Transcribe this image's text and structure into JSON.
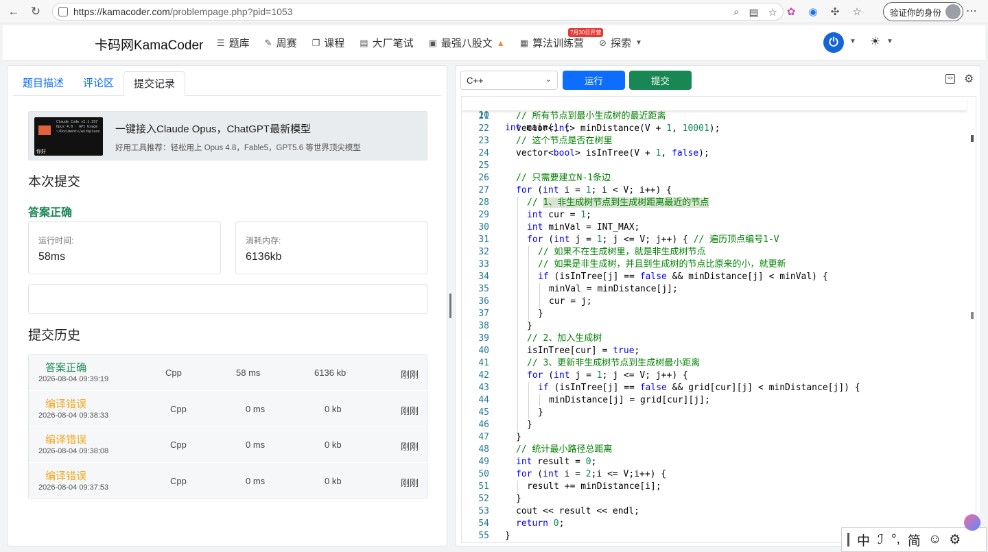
{
  "browser": {
    "url_host": "https://kamacoder.com",
    "url_path": "/problempage.php?pid=1053",
    "profile_label": "验证你的身份"
  },
  "site": {
    "brand": "卡码网KamaCoder",
    "nav": [
      "题库",
      "周赛",
      "课程",
      "大厂笔试",
      "最强八股文",
      "算法训练营",
      "探索"
    ],
    "nav_badge": "7月30日开营"
  },
  "left": {
    "tabs": [
      "题目描述",
      "评论区",
      "提交记录"
    ],
    "promo": {
      "thumb_lines": [
        "Claude Code v2.1.197",
        "Opus 4.8 · API Usage",
        "~/Documents/workplace"
      ],
      "thumb_watermark": "你好",
      "title": "一键接入Claude Opus，ChatGPT最新模型",
      "subtitle": "好用工具推荐：轻松用上 Opus 4.8，Fable5，GPT5.6 等世界顶尖模型"
    },
    "this_submission": "本次提交",
    "verdict": "答案正确",
    "runtime_label": "运行时间:",
    "runtime_value": "58ms",
    "memory_label": "消耗内存:",
    "memory_value": "6136kb",
    "history_title": "提交历史",
    "history": [
      {
        "status": "答案正确",
        "kind": "ok",
        "date": "2026-08-04 09:39:19",
        "lang": "Cpp",
        "time": "58 ms",
        "mem": "6136 kb",
        "when": "刚刚"
      },
      {
        "status": "编译错误",
        "kind": "err",
        "date": "2026-08-04 09:38:33",
        "lang": "Cpp",
        "time": "0 ms",
        "mem": "0 kb",
        "when": "刚刚"
      },
      {
        "status": "编译错误",
        "kind": "err",
        "date": "2026-08-04 09:38:08",
        "lang": "Cpp",
        "time": "0 ms",
        "mem": "0 kb",
        "when": "刚刚"
      },
      {
        "status": "编译错误",
        "kind": "err",
        "date": "2026-08-04 09:37:53",
        "lang": "Cpp",
        "time": "0 ms",
        "mem": "0 kb",
        "when": "刚刚"
      }
    ]
  },
  "editor": {
    "language": "C++",
    "run_label": "运行",
    "submit_label": "提交",
    "sticky": {
      "num": "10",
      "code": "int main() {"
    },
    "lines": [
      {
        "n": "21",
        "i": 1,
        "t": "// 所有节点到最小生成树的最近距离"
      },
      {
        "n": "22",
        "i": 1,
        "t": "vector<int> minDistance(V + 1, 10001);"
      },
      {
        "n": "23",
        "i": 1,
        "t": "// 这个节点是否在树里"
      },
      {
        "n": "24",
        "i": 1,
        "t": "vector<bool> isInTree(V + 1, false);"
      },
      {
        "n": "25",
        "i": 0,
        "t": ""
      },
      {
        "n": "26",
        "i": 1,
        "t": "// 只需要建立N-1条边"
      },
      {
        "n": "27",
        "i": 1,
        "t": "for (int i = 1; i < V; i++) {"
      },
      {
        "n": "28",
        "i": 2,
        "t": "// 1、非生成树节点到生成树距离最近的节点"
      },
      {
        "n": "29",
        "i": 2,
        "t": "int cur = 1;"
      },
      {
        "n": "30",
        "i": 2,
        "t": "int minVal = INT_MAX;"
      },
      {
        "n": "31",
        "i": 2,
        "t": "for (int j = 1; j <= V; j++) { // 遍历顶点编号1-V"
      },
      {
        "n": "32",
        "i": 3,
        "t": "// 如果不在生成树里，就是非生成树节点"
      },
      {
        "n": "33",
        "i": 3,
        "t": "// 如果是非生成树，并且到生成树的节点比原来的小，就更新"
      },
      {
        "n": "34",
        "i": 3,
        "t": "if (isInTree[j] == false && minDistance[j] < minVal) {"
      },
      {
        "n": "35",
        "i": 4,
        "t": "minVal = minDistance[j];"
      },
      {
        "n": "36",
        "i": 4,
        "t": "cur = j;"
      },
      {
        "n": "37",
        "i": 3,
        "t": "}"
      },
      {
        "n": "38",
        "i": 2,
        "t": "}"
      },
      {
        "n": "39",
        "i": 2,
        "t": "// 2、加入生成树"
      },
      {
        "n": "40",
        "i": 2,
        "t": "isInTree[cur] = true;"
      },
      {
        "n": "41",
        "i": 2,
        "t": "// 3、更新非生成树节点到生成树最小距离"
      },
      {
        "n": "42",
        "i": 2,
        "t": "for (int j = 1; j <= V; j++) {"
      },
      {
        "n": "43",
        "i": 3,
        "t": "if (isInTree[j] == false && grid[cur][j] < minDistance[j]) {"
      },
      {
        "n": "44",
        "i": 4,
        "t": "minDistance[j] = grid[cur][j];"
      },
      {
        "n": "45",
        "i": 3,
        "t": "}"
      },
      {
        "n": "46",
        "i": 2,
        "t": "}"
      },
      {
        "n": "47",
        "i": 1,
        "t": "}"
      },
      {
        "n": "48",
        "i": 1,
        "t": "// 统计最小路径总距离"
      },
      {
        "n": "49",
        "i": 1,
        "t": "int result = 0;"
      },
      {
        "n": "50",
        "i": 1,
        "t": "for (int i = 2;i <= V;i++) {"
      },
      {
        "n": "51",
        "i": 2,
        "t": "result += minDistance[i];"
      },
      {
        "n": "52",
        "i": 1,
        "t": "}"
      },
      {
        "n": "53",
        "i": 1,
        "t": "cout << result << endl;"
      },
      {
        "n": "54",
        "i": 1,
        "t": "return 0;"
      },
      {
        "n": "55",
        "i": 0,
        "t": "}"
      }
    ],
    "highlight_line": "28"
  },
  "ime": [
    "中",
    "ℐ",
    "°,",
    "简",
    "☺",
    "⚙"
  ]
}
